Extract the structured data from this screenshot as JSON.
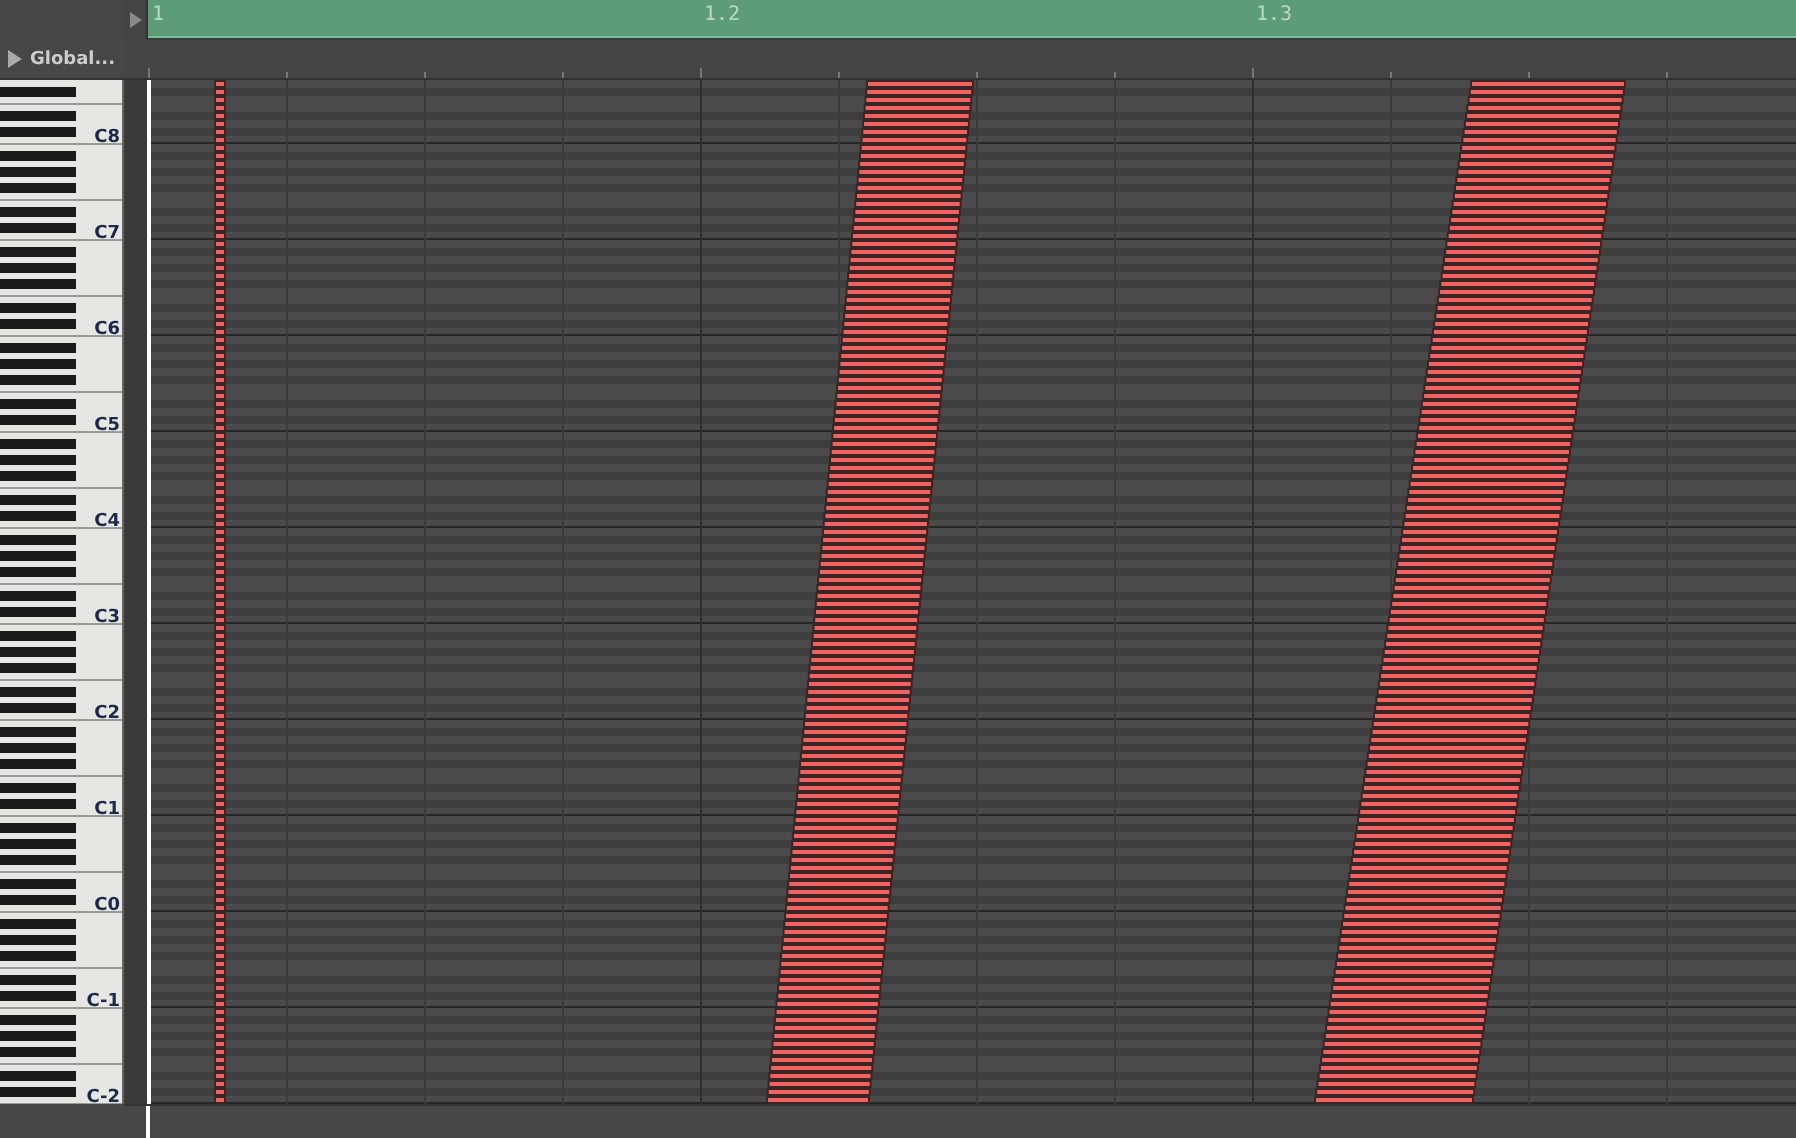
{
  "timeline": {
    "markers": [
      "1",
      "1.2",
      "1.3"
    ]
  },
  "global_track": {
    "label": "Global...",
    "expanded": false
  },
  "keyboard": {
    "labels": [
      "C8",
      "C7",
      "C6",
      "C5",
      "C4",
      "C3",
      "C2",
      "C1",
      "C0",
      "C-1",
      "C-2"
    ]
  }
}
